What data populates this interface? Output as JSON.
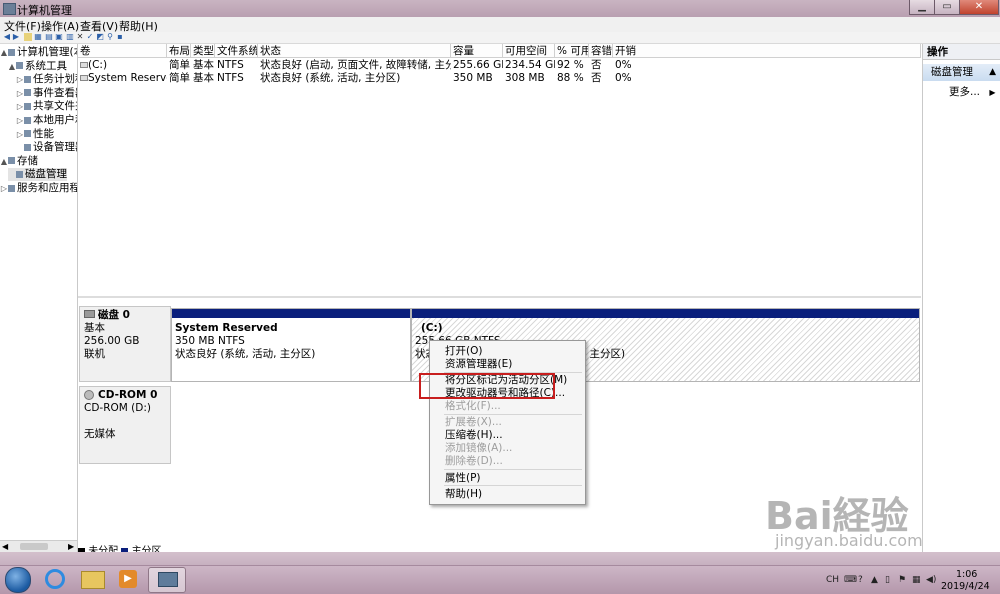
{
  "window": {
    "title": "计算机管理"
  },
  "menu": [
    "文件(F)",
    "操作(A)",
    "查看(V)",
    "帮助(H)"
  ],
  "tree": [
    {
      "label": "计算机管理(本地",
      "indent": 0,
      "expander": "▲"
    },
    {
      "label": "系统工具",
      "indent": 1,
      "expander": "▲"
    },
    {
      "label": "任务计划程",
      "indent": 2,
      "expander": "▷"
    },
    {
      "label": "事件查看器",
      "indent": 2,
      "expander": "▷"
    },
    {
      "label": "共享文件夹",
      "indent": 2,
      "expander": "▷"
    },
    {
      "label": "本地用户和",
      "indent": 2,
      "expander": "▷"
    },
    {
      "label": "性能",
      "indent": 2,
      "expander": "▷"
    },
    {
      "label": "设备管理器",
      "indent": 2,
      "expander": ""
    },
    {
      "label": "存储",
      "indent": 0,
      "expander": "▲"
    },
    {
      "label": "磁盘管理",
      "indent": 1,
      "expander": ""
    },
    {
      "label": "服务和应用程",
      "indent": 0,
      "expander": "▷"
    }
  ],
  "volume_table": {
    "columns": [
      "卷",
      "布局",
      "类型",
      "文件系统",
      "状态",
      "容量",
      "可用空间",
      "% 可用",
      "容错",
      "开销"
    ],
    "rows": [
      [
        "(C:)",
        "简单",
        "基本",
        "NTFS",
        "状态良好 (启动, 页面文件, 故障转储, 主分区)",
        "255.66 GB",
        "234.54 GB",
        "92 %",
        "否",
        "0%"
      ],
      [
        "System Reserved",
        "简单",
        "基本",
        "NTFS",
        "状态良好 (系统, 活动, 主分区)",
        "350 MB",
        "308 MB",
        "88 %",
        "否",
        "0%"
      ]
    ]
  },
  "disks": [
    {
      "name": "磁盘 0",
      "kind": "基本",
      "size": "256.00 GB",
      "status": "联机",
      "partitions": [
        {
          "name": "System Reserved",
          "line2": "350 MB NTFS",
          "line3": "状态良好 (系统, 活动, 主分区)"
        },
        {
          "name": "(C:)",
          "line2": "255.66 GB NTFS",
          "line3": "状态良好 (启动, 页面文件, 故障转储, 主分区)"
        }
      ]
    },
    {
      "name": "CD-ROM 0",
      "kind": "CD-ROM (D:)",
      "status": "无媒体"
    }
  ],
  "legend": [
    "未分配",
    "主分区"
  ],
  "actions": {
    "header": "操作",
    "section": "磁盘管理",
    "more": "更多..."
  },
  "context_menu": {
    "items": [
      {
        "label": "打开(O)",
        "disabled": false
      },
      {
        "label": "资源管理器(E)",
        "disabled": false
      },
      {
        "label": "将分区标记为活动分区(M)",
        "disabled": false
      },
      {
        "label": "更改驱动器号和路径(C)...",
        "disabled": false
      },
      {
        "label": "格式化(F)...",
        "disabled": true
      },
      {
        "label": "扩展卷(X)...",
        "disabled": true
      },
      {
        "label": "压缩卷(H)...",
        "disabled": false
      },
      {
        "label": "添加镜像(A)...",
        "disabled": true
      },
      {
        "label": "删除卷(D)...",
        "disabled": true
      },
      {
        "label": "属性(P)",
        "disabled": false
      },
      {
        "label": "帮助(H)",
        "disabled": false
      }
    ]
  },
  "taskbar": {
    "lang": "CH",
    "time": "1:06",
    "date": "2019/4/24"
  },
  "watermark": {
    "brand": "Bai経验",
    "url": "jingyan.baidu.com"
  },
  "colors": {
    "partition_bar": "#0a1f7c",
    "highlight_box": "#c81e1e",
    "selection": "#c9dcf0"
  }
}
